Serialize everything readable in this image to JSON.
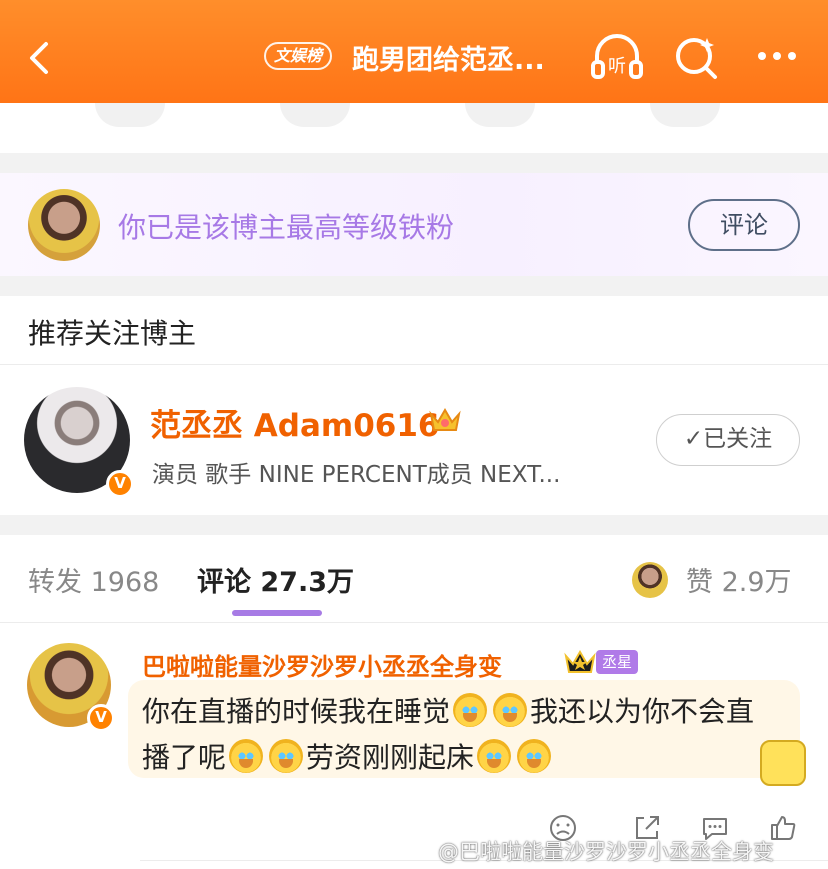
{
  "header": {
    "tag": "文娱榜",
    "title": "跑男团给范丞...",
    "listen_icon": "listen-icon",
    "search_icon": "sparkle-search-icon",
    "more_icon": "more-icon"
  },
  "fan_bar": {
    "text": "你已是该博主最高等级铁粉",
    "button": "评论"
  },
  "recommend": {
    "title": "推荐关注博主",
    "name": "范丞丞 Adam0616",
    "desc": "演员 歌手 NINE PERCENT成员 NEXT...",
    "follow": "已关注"
  },
  "tabs": {
    "forward": "转发 1968",
    "comment": "评论 27.3万",
    "like": "赞 2.9万"
  },
  "comment": {
    "name": "巴啦啦能量沙罗沙罗小丞丞全身变",
    "badge": "丞星",
    "text_part1": "你在直播的时候我在睡觉",
    "text_part2": "我还以为你不会直播了呢",
    "text_part3": "劳资刚刚起床"
  },
  "watermark": "@巴啦啦能量沙罗沙罗小丞丞全身变",
  "colors": {
    "header": "#ff7a1a",
    "orange_name": "#f06100",
    "purple": "#a779e6"
  }
}
